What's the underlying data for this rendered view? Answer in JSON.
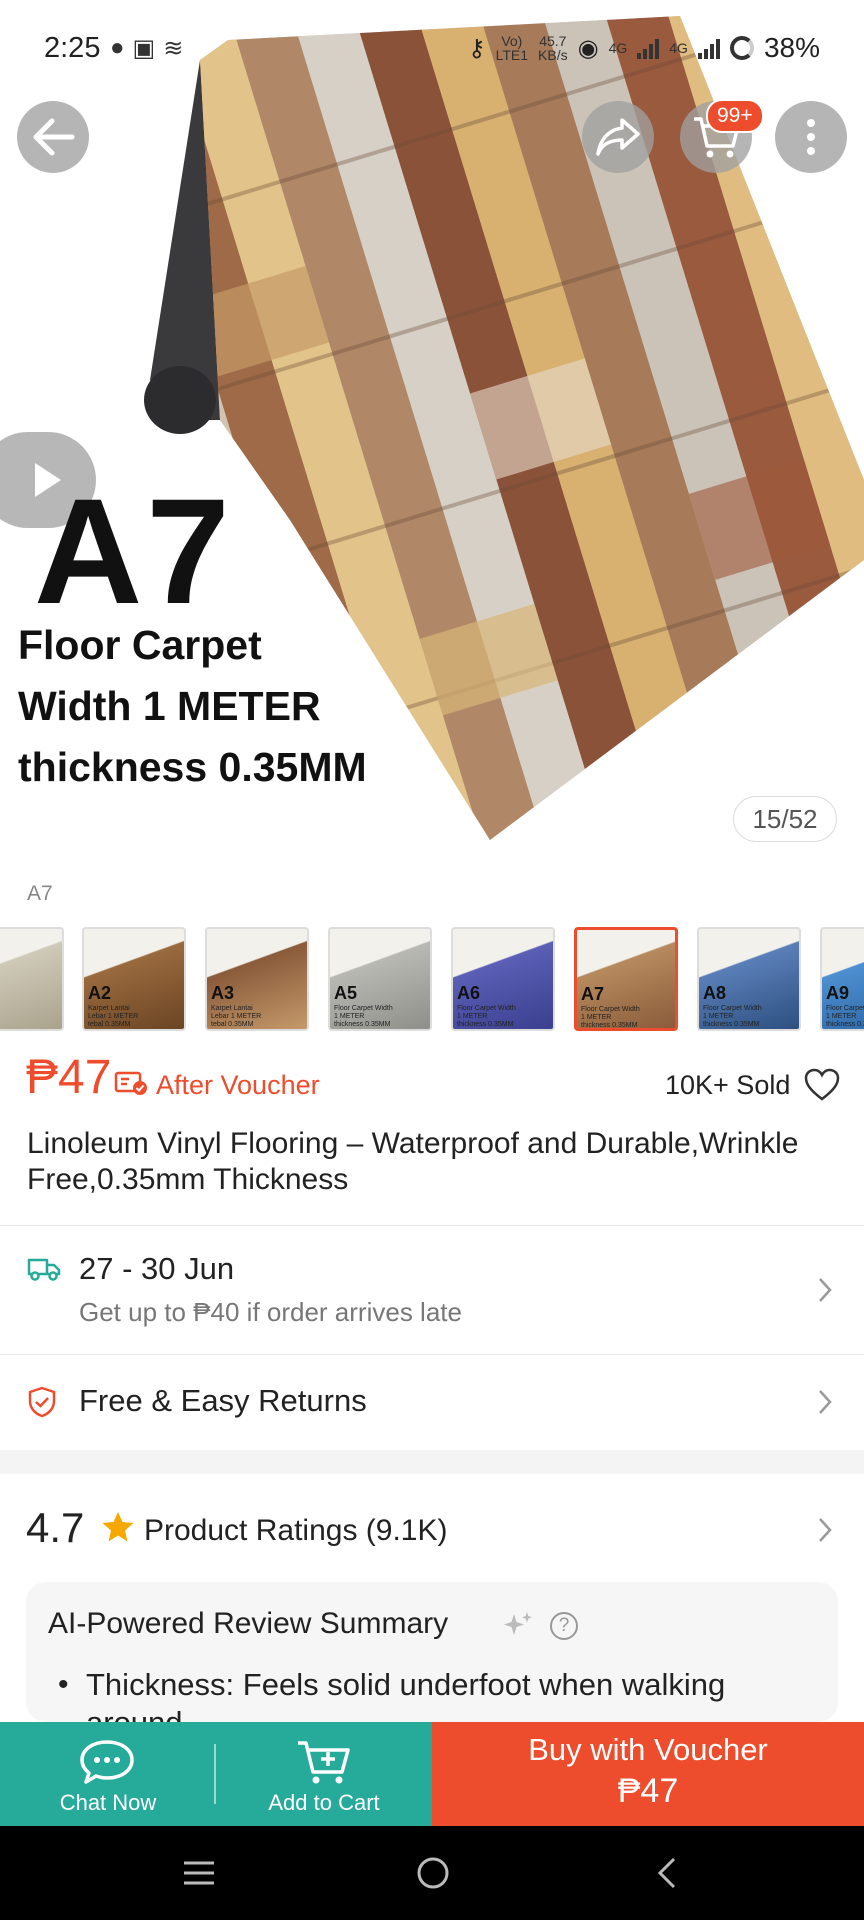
{
  "status_bar": {
    "time": "2:25",
    "network_speed": "45.7",
    "speed_unit": "KB/s",
    "volte_top": "Vo)",
    "volte_bottom": "LTE1",
    "net_1": "4G",
    "net_2": "4G",
    "battery": "38%"
  },
  "header": {
    "cart_badge": "99+"
  },
  "hero": {
    "code": "A7",
    "line_1": "Floor Carpet",
    "line_2": "Width 1 METER",
    "line_3": "thickness 0.35MM",
    "counter": "15/52"
  },
  "variants": {
    "selected_label": "A7",
    "items": [
      {
        "code": "",
        "sub": "",
        "color": "#cfcab8",
        "accent": "#a9a38d"
      },
      {
        "code": "A2",
        "sub": "Karpet Lantai Lebar 1 METER tebal 0.35MM",
        "color": "#9a6a3e",
        "accent": "#6b4524"
      },
      {
        "code": "A3",
        "sub": "Karpet Lantai Lebar 1 METER tebal 0.35MM",
        "color": "#8a5a3a",
        "accent": "#c49a6a"
      },
      {
        "code": "A5",
        "sub": "Floor Carpet Width 1 METER thickness 0.35MM",
        "color": "#b9b9b4",
        "accent": "#8f8f8a"
      },
      {
        "code": "A6",
        "sub": "Floor Carpet Width 1 METER thickness 0.35MM",
        "color": "#5b5fb5",
        "accent": "#3b3f8f"
      },
      {
        "code": "A7",
        "sub": "Floor Carpet Width 1 METER thickness 0.35MM",
        "color": "#b78a5e",
        "accent": "#8a5c3a"
      },
      {
        "code": "A8",
        "sub": "Floor Carpet Width 1 METER thickness 0.35MM",
        "color": "#5a7fb8",
        "accent": "#2d4f80"
      },
      {
        "code": "A9",
        "sub": "Floor Carpet Width 1 METER thickness 0.35MM",
        "color": "#4d8fd0",
        "accent": "#2a62a0"
      }
    ]
  },
  "price": {
    "amount": "₱47",
    "after_voucher": "After Voucher",
    "sold": "10K+ Sold"
  },
  "product": {
    "title": "Linoleum Vinyl Flooring – Waterproof and Durable,Wrinkle Free,0.35mm Thickness"
  },
  "delivery": {
    "dates": "27 - 30 Jun",
    "guarantee": "Get up to ₱40 if order arrives late"
  },
  "returns": {
    "label": "Free & Easy Returns"
  },
  "ratings": {
    "score": "4.7",
    "label": "Product Ratings (9.1K)"
  },
  "ai_summary": {
    "title": "AI-Powered Review Summary",
    "help": "?",
    "bullet": "•",
    "point": "Thickness: Feels solid underfoot when walking around"
  },
  "bottom_bar": {
    "chat_label": "Chat Now",
    "cart_label": "Add to Cart",
    "buy_label": "Buy with Voucher",
    "buy_price": "₱47"
  },
  "colors": {
    "brand": "#ee4d2d",
    "teal": "#26aa99",
    "star": "#f6a700"
  },
  "icons": [
    "back-arrow-icon",
    "share-icon",
    "cart-icon",
    "more-vert-icon",
    "play-icon",
    "voucher-icon",
    "heart-icon",
    "truck-icon",
    "shield-check-icon",
    "chevron-right-icon",
    "star-icon",
    "sparkle-icon",
    "help-icon",
    "chat-icon",
    "add-cart-icon",
    "menu-icon",
    "home-icon",
    "nav-back-icon"
  ]
}
